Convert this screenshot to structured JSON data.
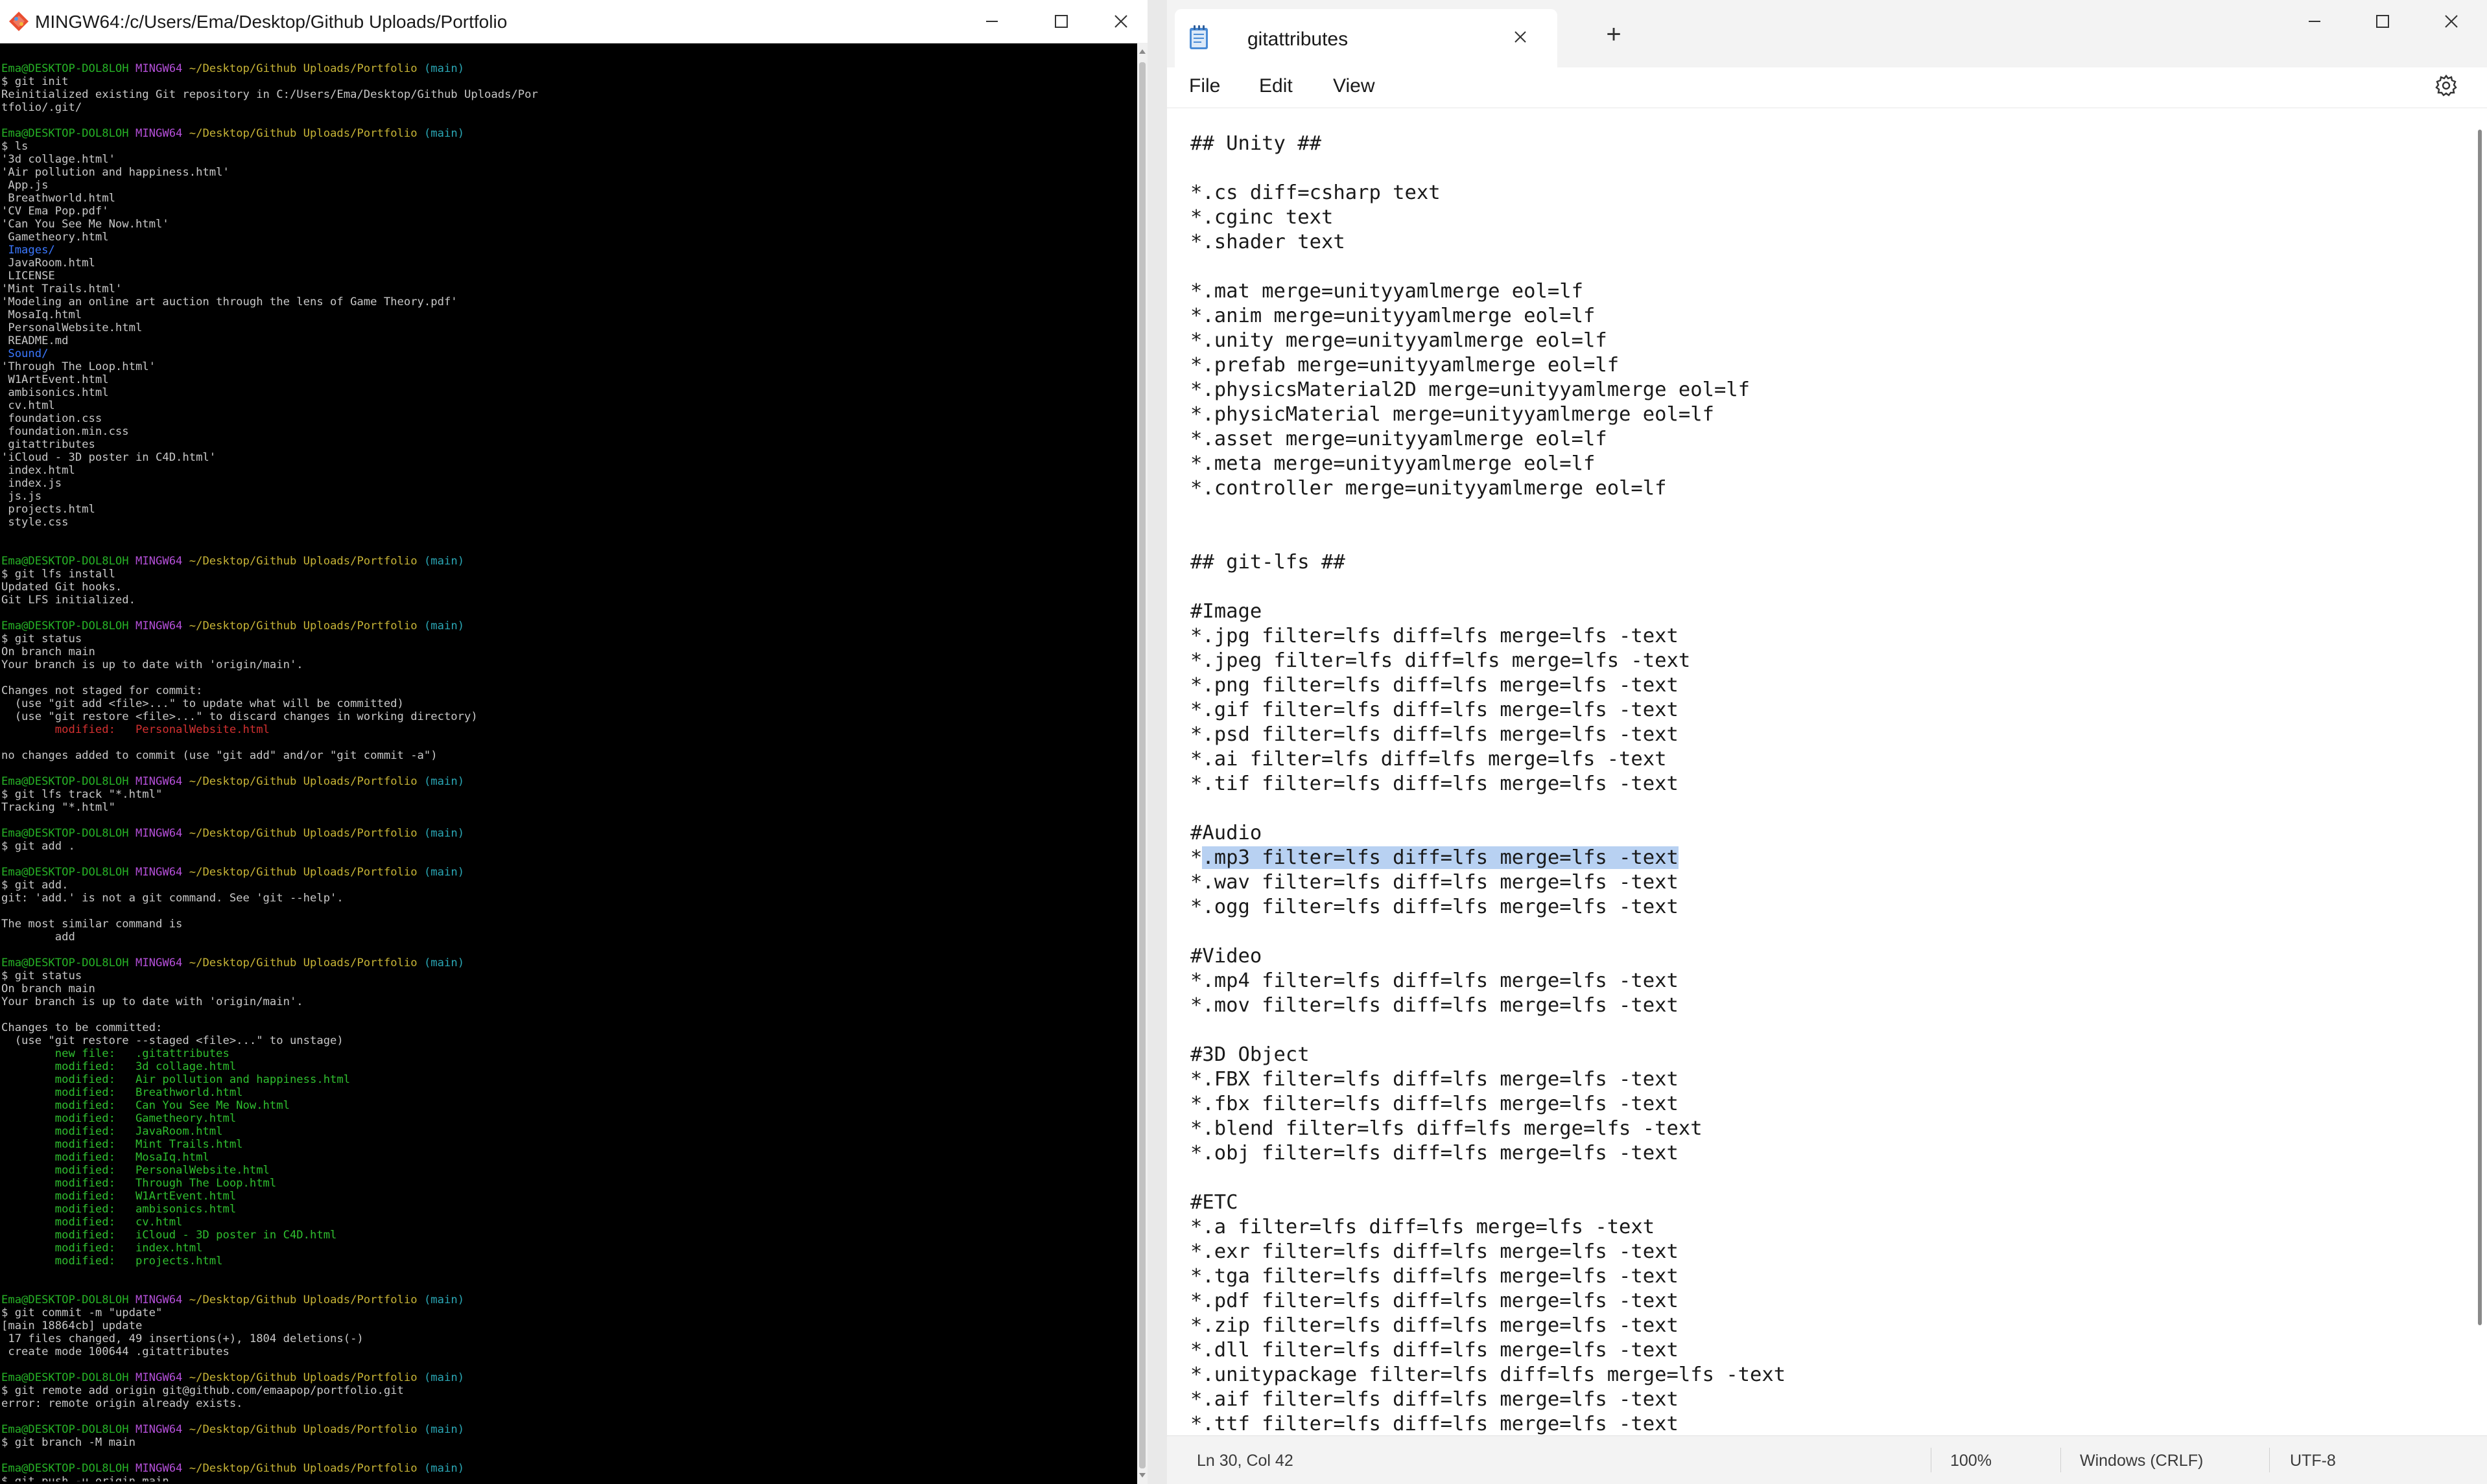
{
  "terminal": {
    "title": "MINGW64:/c/Users/Ema/Desktop/Github Uploads/Portfolio",
    "prompt": {
      "user_host": "Ema@DESKTOP-DOL8LOH",
      "shell": "MINGW64",
      "path": "~/Desktop/Github Uploads/Portfolio",
      "branch": "(main)"
    },
    "blocks": [
      {
        "command": "$ git init",
        "output": [
          {
            "text": "Reinitialized existing Git repository in C:/Users/Ema/Desktop/Github Uploads/Por"
          },
          {
            "text": "tfolio/.git/"
          }
        ]
      },
      {
        "command": "$ ls",
        "output": [
          {
            "text": "'3d collage.html'"
          },
          {
            "text": "'Air pollution and happiness.html'"
          },
          {
            "text": " App.js"
          },
          {
            "text": " Breathworld.html"
          },
          {
            "text": "'CV Ema Pop.pdf'"
          },
          {
            "text": "'Can You See Me Now.html'"
          },
          {
            "text": " Gametheory.html"
          },
          {
            "text": " Images/",
            "color": "blue"
          },
          {
            "text": " JavaRoom.html"
          },
          {
            "text": " LICENSE"
          },
          {
            "text": "'Mint Trails.html'"
          },
          {
            "text": "'Modeling an online art auction through the lens of Game Theory.pdf'"
          },
          {
            "text": " MosaIq.html"
          },
          {
            "text": " PersonalWebsite.html"
          },
          {
            "text": " README.md"
          },
          {
            "text": " Sound/",
            "color": "blue"
          },
          {
            "text": "'Through The Loop.html'"
          },
          {
            "text": " W1ArtEvent.html"
          },
          {
            "text": " ambisonics.html"
          },
          {
            "text": " cv.html"
          },
          {
            "text": " foundation.css"
          },
          {
            "text": " foundation.min.css"
          },
          {
            "text": " gitattributes"
          },
          {
            "text": "'iCloud - 3D poster in C4D.html'"
          },
          {
            "text": " index.html"
          },
          {
            "text": " index.js"
          },
          {
            "text": " js.js"
          },
          {
            "text": " projects.html"
          },
          {
            "text": " style.css"
          },
          {
            "text": ""
          }
        ]
      },
      {
        "command": "$ git lfs install",
        "output": [
          {
            "text": "Updated Git hooks."
          },
          {
            "text": "Git LFS initialized."
          }
        ]
      },
      {
        "command": "$ git status",
        "output": [
          {
            "text": "On branch main"
          },
          {
            "text": "Your branch is up to date with 'origin/main'."
          },
          {
            "text": ""
          },
          {
            "text": "Changes not staged for commit:"
          },
          {
            "text": "  (use \"git add <file>...\" to update what will be committed)"
          },
          {
            "text": "  (use \"git restore <file>...\" to discard changes in working directory)"
          },
          {
            "text": "        modified:   PersonalWebsite.html",
            "color": "red"
          },
          {
            "text": ""
          },
          {
            "text": "no changes added to commit (use \"git add\" and/or \"git commit -a\")"
          }
        ]
      },
      {
        "command": "$ git lfs track \"*.html\"",
        "output": [
          {
            "text": "Tracking \"*.html\""
          }
        ]
      },
      {
        "command": "$ git add .",
        "output": []
      },
      {
        "command": "$ git add.",
        "output": [
          {
            "text": "git: 'add.' is not a git command. See 'git --help'."
          },
          {
            "text": ""
          },
          {
            "text": "The most similar command is"
          },
          {
            "text": "        add"
          }
        ]
      },
      {
        "command": "$ git status",
        "output": [
          {
            "text": "On branch main"
          },
          {
            "text": "Your branch is up to date with 'origin/main'."
          },
          {
            "text": ""
          },
          {
            "text": "Changes to be committed:"
          },
          {
            "text": "  (use \"git restore --staged <file>...\" to unstage)"
          },
          {
            "text": "        new file:   .gitattributes",
            "color": "ok"
          },
          {
            "text": "        modified:   3d collage.html",
            "color": "ok"
          },
          {
            "text": "        modified:   Air pollution and happiness.html",
            "color": "ok"
          },
          {
            "text": "        modified:   Breathworld.html",
            "color": "ok"
          },
          {
            "text": "        modified:   Can You See Me Now.html",
            "color": "ok"
          },
          {
            "text": "        modified:   Gametheory.html",
            "color": "ok"
          },
          {
            "text": "        modified:   JavaRoom.html",
            "color": "ok"
          },
          {
            "text": "        modified:   Mint Trails.html",
            "color": "ok"
          },
          {
            "text": "        modified:   MosaIq.html",
            "color": "ok"
          },
          {
            "text": "        modified:   PersonalWebsite.html",
            "color": "ok"
          },
          {
            "text": "        modified:   Through The Loop.html",
            "color": "ok"
          },
          {
            "text": "        modified:   W1ArtEvent.html",
            "color": "ok"
          },
          {
            "text": "        modified:   ambisonics.html",
            "color": "ok"
          },
          {
            "text": "        modified:   cv.html",
            "color": "ok"
          },
          {
            "text": "        modified:   iCloud - 3D poster in C4D.html",
            "color": "ok"
          },
          {
            "text": "        modified:   index.html",
            "color": "ok"
          },
          {
            "text": "        modified:   projects.html",
            "color": "ok"
          },
          {
            "text": ""
          }
        ]
      },
      {
        "command": "$ git commit -m \"update\"",
        "output": [
          {
            "text": "[main 18864cb] update"
          },
          {
            "text": " 17 files changed, 49 insertions(+), 1804 deletions(-)"
          },
          {
            "text": " create mode 100644 .gitattributes"
          }
        ]
      },
      {
        "command": "$ git remote add origin git@github.com/emaapop/portfolio.git",
        "output": [
          {
            "text": "error: remote origin already exists."
          }
        ]
      },
      {
        "command": "$ git branch -M main",
        "output": []
      },
      {
        "command": "$ git push -u origin main",
        "output": []
      }
    ],
    "cursor": "█"
  },
  "notepad": {
    "tab_title": "gitattributes",
    "new_tab_label": "+",
    "menu": [
      "File",
      "Edit",
      "View"
    ],
    "lines": [
      "## Unity ##",
      "",
      "*.cs diff=csharp text",
      "*.cginc text",
      "*.shader text",
      "",
      "*.mat merge=unityyamlmerge eol=lf",
      "*.anim merge=unityyamlmerge eol=lf",
      "*.unity merge=unityyamlmerge eol=lf",
      "*.prefab merge=unityyamlmerge eol=lf",
      "*.physicsMaterial2D merge=unityyamlmerge eol=lf",
      "*.physicMaterial merge=unityyamlmerge eol=lf",
      "*.asset merge=unityyamlmerge eol=lf",
      "*.meta merge=unityyamlmerge eol=lf",
      "*.controller merge=unityyamlmerge eol=lf",
      "",
      "",
      "## git-lfs ##",
      "",
      "#Image",
      "*.jpg filter=lfs diff=lfs merge=lfs -text",
      "*.jpeg filter=lfs diff=lfs merge=lfs -text",
      "*.png filter=lfs diff=lfs merge=lfs -text",
      "*.gif filter=lfs diff=lfs merge=lfs -text",
      "*.psd filter=lfs diff=lfs merge=lfs -text",
      "*.ai filter=lfs diff=lfs merge=lfs -text",
      "*.tif filter=lfs diff=lfs merge=lfs -text",
      "",
      "#Audio",
      "*.mp3 filter=lfs diff=lfs merge=lfs -text",
      "*.wav filter=lfs diff=lfs merge=lfs -text",
      "*.ogg filter=lfs diff=lfs merge=lfs -text",
      "",
      "#Video",
      "*.mp4 filter=lfs diff=lfs merge=lfs -text",
      "*.mov filter=lfs diff=lfs merge=lfs -text",
      "",
      "#3D Object",
      "*.FBX filter=lfs diff=lfs merge=lfs -text",
      "*.fbx filter=lfs diff=lfs merge=lfs -text",
      "*.blend filter=lfs diff=lfs merge=lfs -text",
      "*.obj filter=lfs diff=lfs merge=lfs -text",
      "",
      "#ETC",
      "*.a filter=lfs diff=lfs merge=lfs -text",
      "*.exr filter=lfs diff=lfs merge=lfs -text",
      "*.tga filter=lfs diff=lfs merge=lfs -text",
      "*.pdf filter=lfs diff=lfs merge=lfs -text",
      "*.zip filter=lfs diff=lfs merge=lfs -text",
      "*.dll filter=lfs diff=lfs merge=lfs -text",
      "*.unitypackage filter=lfs diff=lfs merge=lfs -text",
      "*.aif filter=lfs diff=lfs merge=lfs -text",
      "*.ttf filter=lfs diff=lfs merge=lfs -text"
    ],
    "selection": {
      "line": 29,
      "prefix": "*",
      "selected": ".mp3 filter=lfs diff=lfs merge=lfs -text"
    },
    "status": {
      "position": "Ln 30, Col 42",
      "zoom": "100%",
      "line_ending": "Windows (CRLF)",
      "encoding": "UTF-8"
    }
  },
  "colors": {
    "terminal_bg": "#000000",
    "prompt_user": "#26b226",
    "prompt_shell": "#b44fd8",
    "prompt_path": "#c7b436",
    "prompt_branch": "#2aa7b5",
    "dir": "#3b78ff",
    "unstaged": "#d33030",
    "staged": "#2fbf2f",
    "selection": "#b8d1f2"
  },
  "icons": {
    "terminal_app": "git-bash-icon",
    "notepad_app": "notepad-icon",
    "minimize": "minimize-icon",
    "maximize": "maximize-icon",
    "close": "close-icon",
    "settings": "gear-icon"
  }
}
